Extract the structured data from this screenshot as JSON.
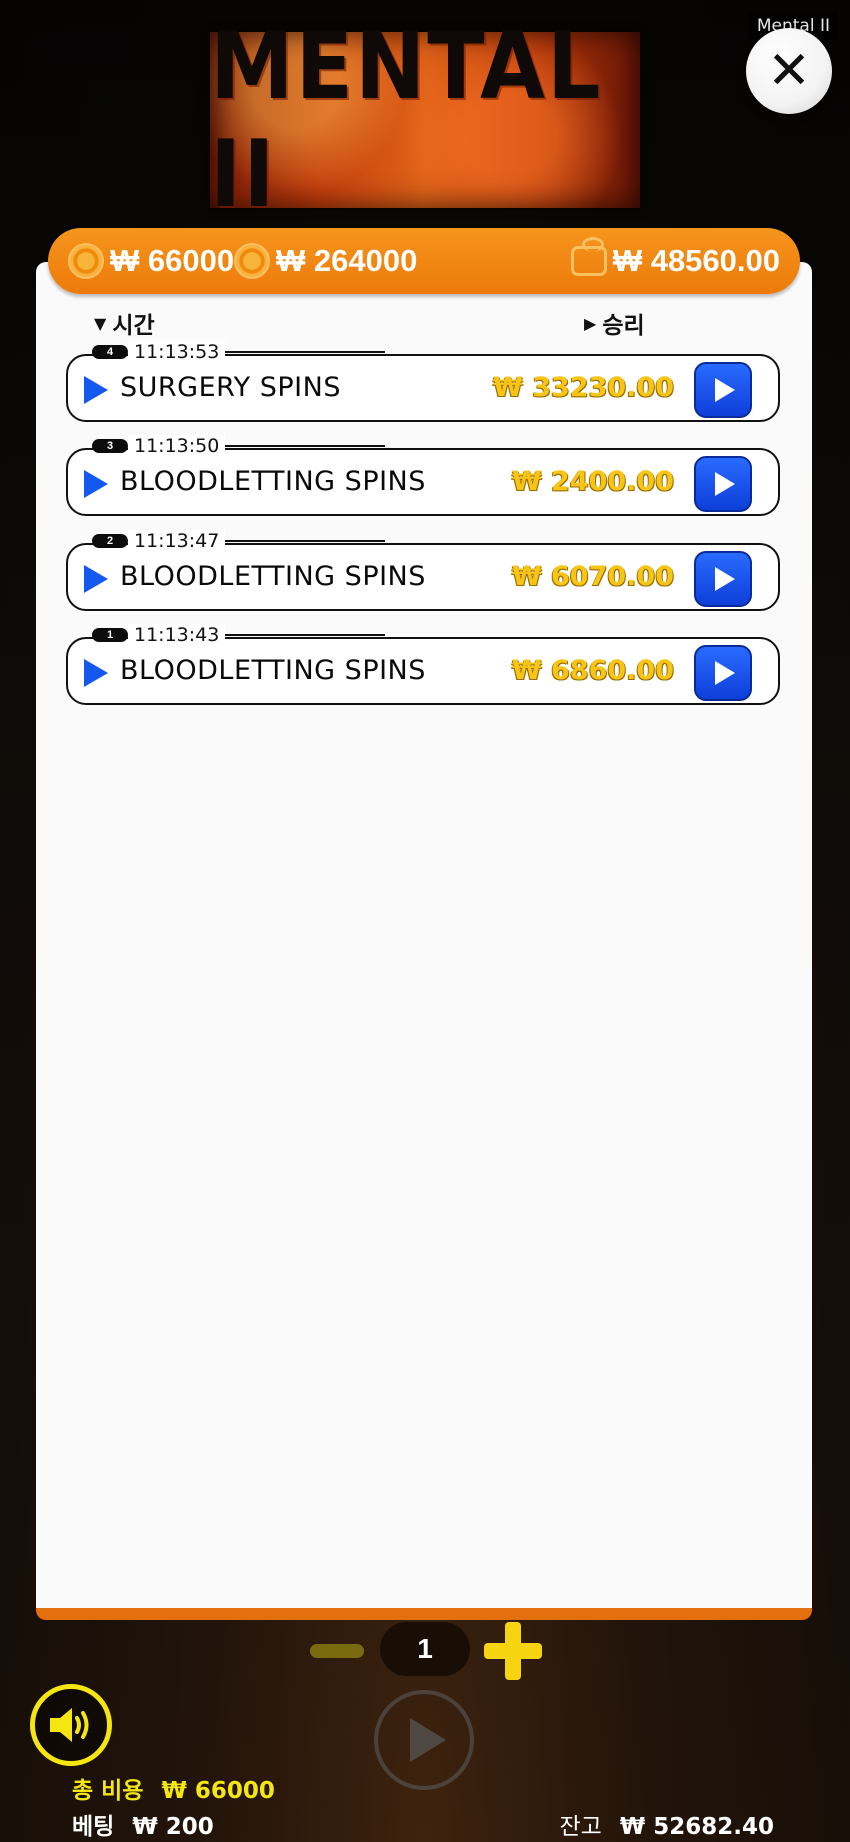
{
  "window": {
    "title": "Mental II"
  },
  "logo": {
    "text": "MENTAL II"
  },
  "topbar": {
    "cost_1": "₩ 66000",
    "cost_2": "₩ 264000",
    "wallet": "₩ 48560.00"
  },
  "columns": {
    "time": "시간",
    "win": "승리"
  },
  "rows": [
    {
      "badge": "4",
      "time": "11:13:53",
      "label": "SURGERY SPINS",
      "amount": "₩ 33230.00"
    },
    {
      "badge": "3",
      "time": "11:13:50",
      "label": "BLOODLETTING SPINS",
      "amount": "₩ 2400.00"
    },
    {
      "badge": "2",
      "time": "11:13:47",
      "label": "BLOODLETTING SPINS",
      "amount": "₩ 6070.00"
    },
    {
      "badge": "1",
      "time": "11:13:43",
      "label": "BLOODLETTING SPINS",
      "amount": "₩ 6860.00"
    }
  ],
  "pager": {
    "page": "1"
  },
  "footer": {
    "total_cost_label": "총 비용",
    "total_cost_value": "₩ 66000",
    "bet_label": "베팅",
    "bet_value": "₩ 200",
    "balance_label": "잔고",
    "balance_value": "₩ 52682.40"
  },
  "colors": {
    "accent_orange": "#ed7a0b",
    "play_blue": "#1558f0",
    "amount_gold": "#f6c515",
    "footer_yellow": "#f4e60e"
  },
  "icons": [
    "close-icon",
    "coin-icon",
    "wallet-icon",
    "sort-down-icon",
    "sort-right-icon",
    "play-icon",
    "replay-button-icon",
    "sound-icon",
    "minus-icon",
    "plus-icon"
  ]
}
